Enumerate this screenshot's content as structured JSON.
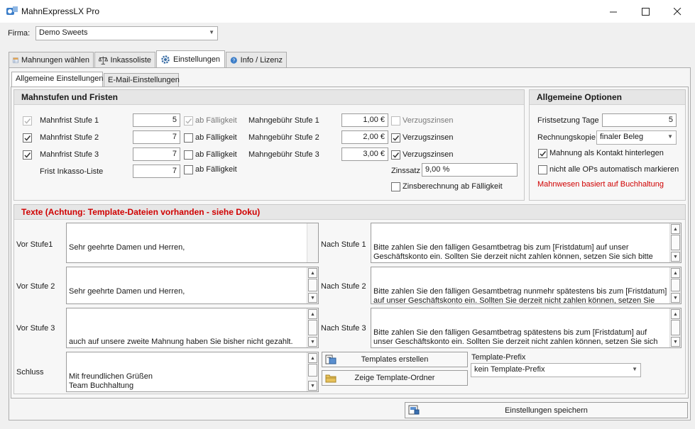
{
  "window": {
    "title": "MahnExpressLX Pro",
    "minimize_icon": "minimize-icon",
    "maximize_icon": "maximize-icon",
    "close_icon": "close-icon"
  },
  "firma": {
    "label": "Firma:",
    "value": "Demo Sweets"
  },
  "tabs": [
    {
      "label": "Mahnungen wählen",
      "icon": "table-icon"
    },
    {
      "label": "Inkassoliste",
      "icon": "scales-icon"
    },
    {
      "label": "Einstellungen",
      "icon": "gear-icon"
    },
    {
      "label": "Info / Lizenz",
      "icon": "help-icon"
    }
  ],
  "subtabs": [
    {
      "label": "Allgemeine Einstellungen"
    },
    {
      "label": "E-Mail-Einstellungen"
    }
  ],
  "mahnstufen": {
    "title": "Mahnstufen und Fristen",
    "rows": [
      {
        "label": "Mahnfrist Stufe 1",
        "value": "5",
        "faelligkeit": "ab Fälligkeit",
        "gebuehr_label": "Mahngebühr Stufe 1",
        "gebuehr": "1,00 €",
        "verzug": "Verzugszinsen"
      },
      {
        "label": "Mahnfrist Stufe 2",
        "value": "7",
        "faelligkeit": "ab Fälligkeit",
        "gebuehr_label": "Mahngebühr Stufe 2",
        "gebuehr": "2,00 €",
        "verzug": "Verzugszinsen"
      },
      {
        "label": "Mahnfrist Stufe 3",
        "value": "7",
        "faelligkeit": "ab Fälligkeit",
        "gebuehr_label": "Mahngebühr Stufe 3",
        "gebuehr": "3,00 €",
        "verzug": "Verzugszinsen"
      }
    ],
    "inkasso": {
      "label": "Frist Inkasso-Liste",
      "value": "7",
      "faelligkeit": "ab Fälligkeit"
    },
    "zinssatz": {
      "label": "Zinssatz",
      "value": "9,00 %"
    },
    "zinsberechnung": "Zinsberechnung ab Fälligkeit"
  },
  "optionen": {
    "title": "Allgemeine Optionen",
    "fristsetzung": {
      "label": "Fristsetzung Tage",
      "value": "5"
    },
    "rechnungskopie": {
      "label": "Rechnungskopie",
      "value": "finaler Beleg"
    },
    "kontakt": "Mahnung als Kontakt hinterlegen",
    "ops": "nicht alle OPs automatisch markieren",
    "hinweis": "Mahnwesen basiert auf Buchhaltung"
  },
  "texte": {
    "title": "Texte (Achtung: Template-Dateien vorhanden - siehe Doku)",
    "vor1": {
      "label": "Vor Stufe1",
      "text": "Sehr geehrte Damen und Herren,\n\nsicher ist es Ihrer Aufmerksamkeit entgangen, dass nachfolgend aufgeführte Rechnung(en) noch nicht ausgeglichen sind."
    },
    "vor2": {
      "label": "Vor Stufe 2",
      "text": "Sehr geehrte Damen und Herren,\n\nleider haben Sie auf unsere erste Mahnung nicht reagiert. Es sind immer noch die nachfolgend aufgeführte(n) Rechnung(en) zur"
    },
    "vor3": {
      "label": "Vor Stufe 3",
      "text": "\nauch auf unsere zweite Mahnung haben Sie bisher nicht gezahlt. Wir fordern Sie hiermit letztmalig außergerichtlich auf, die nachfolgend auf geführte(n) Rechnung(en) umgehend zu begleichen."
    },
    "schluss": {
      "label": "Schluss",
      "text": "Mit freundlichen Grüßen\nTeam Buchhaltung\n\nMusterfirma GmbH\nMusterstraße"
    },
    "nach1": {
      "label": "Nach Stufe 1",
      "text": "Bitte zahlen Sie den fälligen Gesamtbetrag bis zum [Fristdatum] auf unser Geschäftskonto ein. Sollten Sie derzeit nicht zahlen können, setzen Sie sich bitte unverzüglich mit uns in Verbindung, um eine gemeinsame Lösung zu finden und weitere Kosten für Sie zu vermeiden."
    },
    "nach2": {
      "label": "Nach Stufe 2",
      "text": "Bitte zahlen Sie den fälligen Gesamtbetrag nunmehr spätestens bis zum [Fristdatum] auf unser Geschäftskonto ein. Sollten Sie derzeit nicht zahlen können, setzen Sie sich bitte unverzüglich mit uns in Verbindung, um eine gemeinsame Lösung zu finden und weitere erhebliche Kosten für Sie zu vermeiden."
    },
    "nach3": {
      "label": "Nach Stufe 3",
      "text": "Bitte zahlen Sie den fälligen Gesamtbetrag spätestens bis zum [Fristdatum] auf unser Geschäftskonto ein. Sollten Sie derzeit nicht zahlen können, setzen Sie sich bitte unverzüglich mit uns in Verbindung, um eine gemeinsame Lösung zu finden und weitere erhebliche Kosten und Nachteile für Sie zu vermeiden.\nSollten wir nach Ablauf der Frist keinen Zahlungseingang feststellen können"
    },
    "templates_button": "Templates erstellen",
    "ordner_button": "Zeige Template-Ordner",
    "prefix_label": "Template-Prefix",
    "prefix_value": "kein Template-Prefix"
  },
  "save_button": "Einstellungen speichern",
  "colors": {
    "accent_red": "#d00000",
    "background": "#f0f0f0"
  }
}
